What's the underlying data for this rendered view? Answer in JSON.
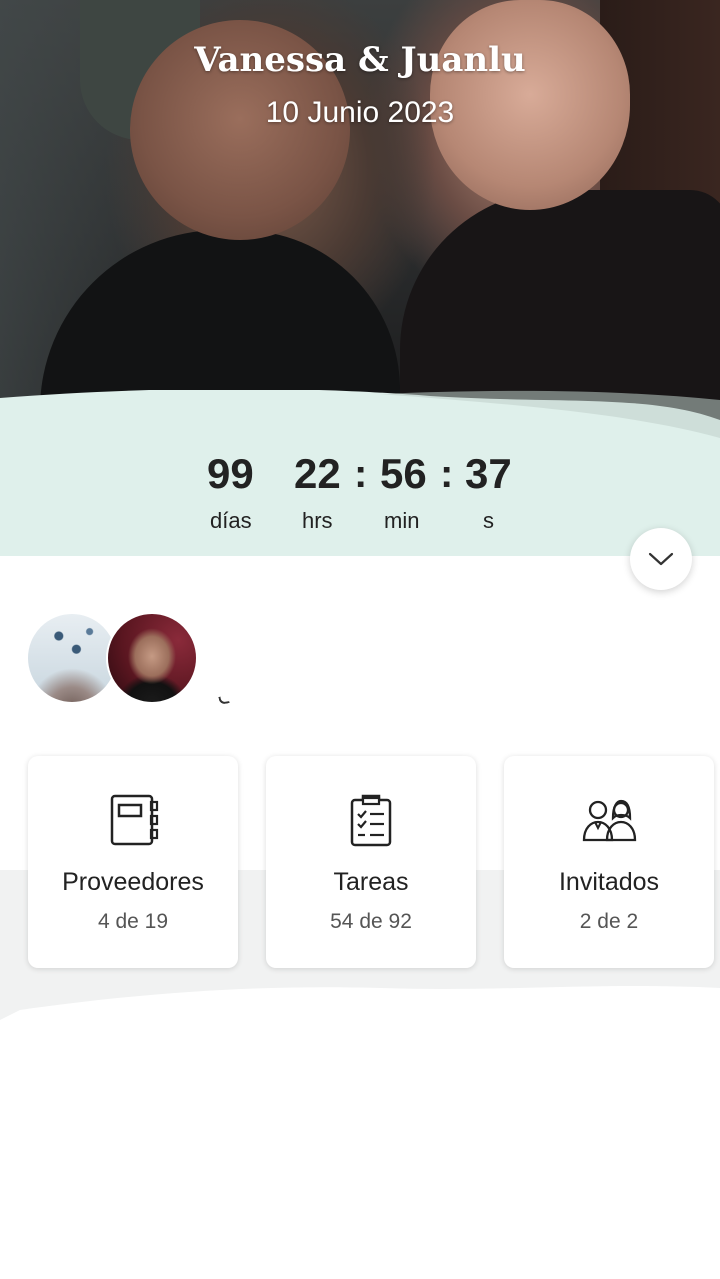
{
  "header": {
    "couple_names": "Vanessa & Juanlu",
    "wedding_date": "10 Junio 2023"
  },
  "countdown": {
    "days": "99",
    "hours": "22",
    "minutes": "56",
    "seconds": "37",
    "sep": ":",
    "days_label": "días",
    "hours_label": "hrs",
    "minutes_label": "min",
    "seconds_label": "s"
  },
  "colors": {
    "mint_band": "#dff0eb",
    "accent": "#222222"
  },
  "cards": [
    {
      "label": "Proveedores",
      "progress": "4 de 19",
      "icon": "notebook-icon"
    },
    {
      "label": "Tareas",
      "progress": "54 de 92",
      "icon": "clipboard-checklist-icon"
    },
    {
      "label": "Invitados",
      "progress": "2 de 2",
      "icon": "guests-couple-icon"
    }
  ]
}
